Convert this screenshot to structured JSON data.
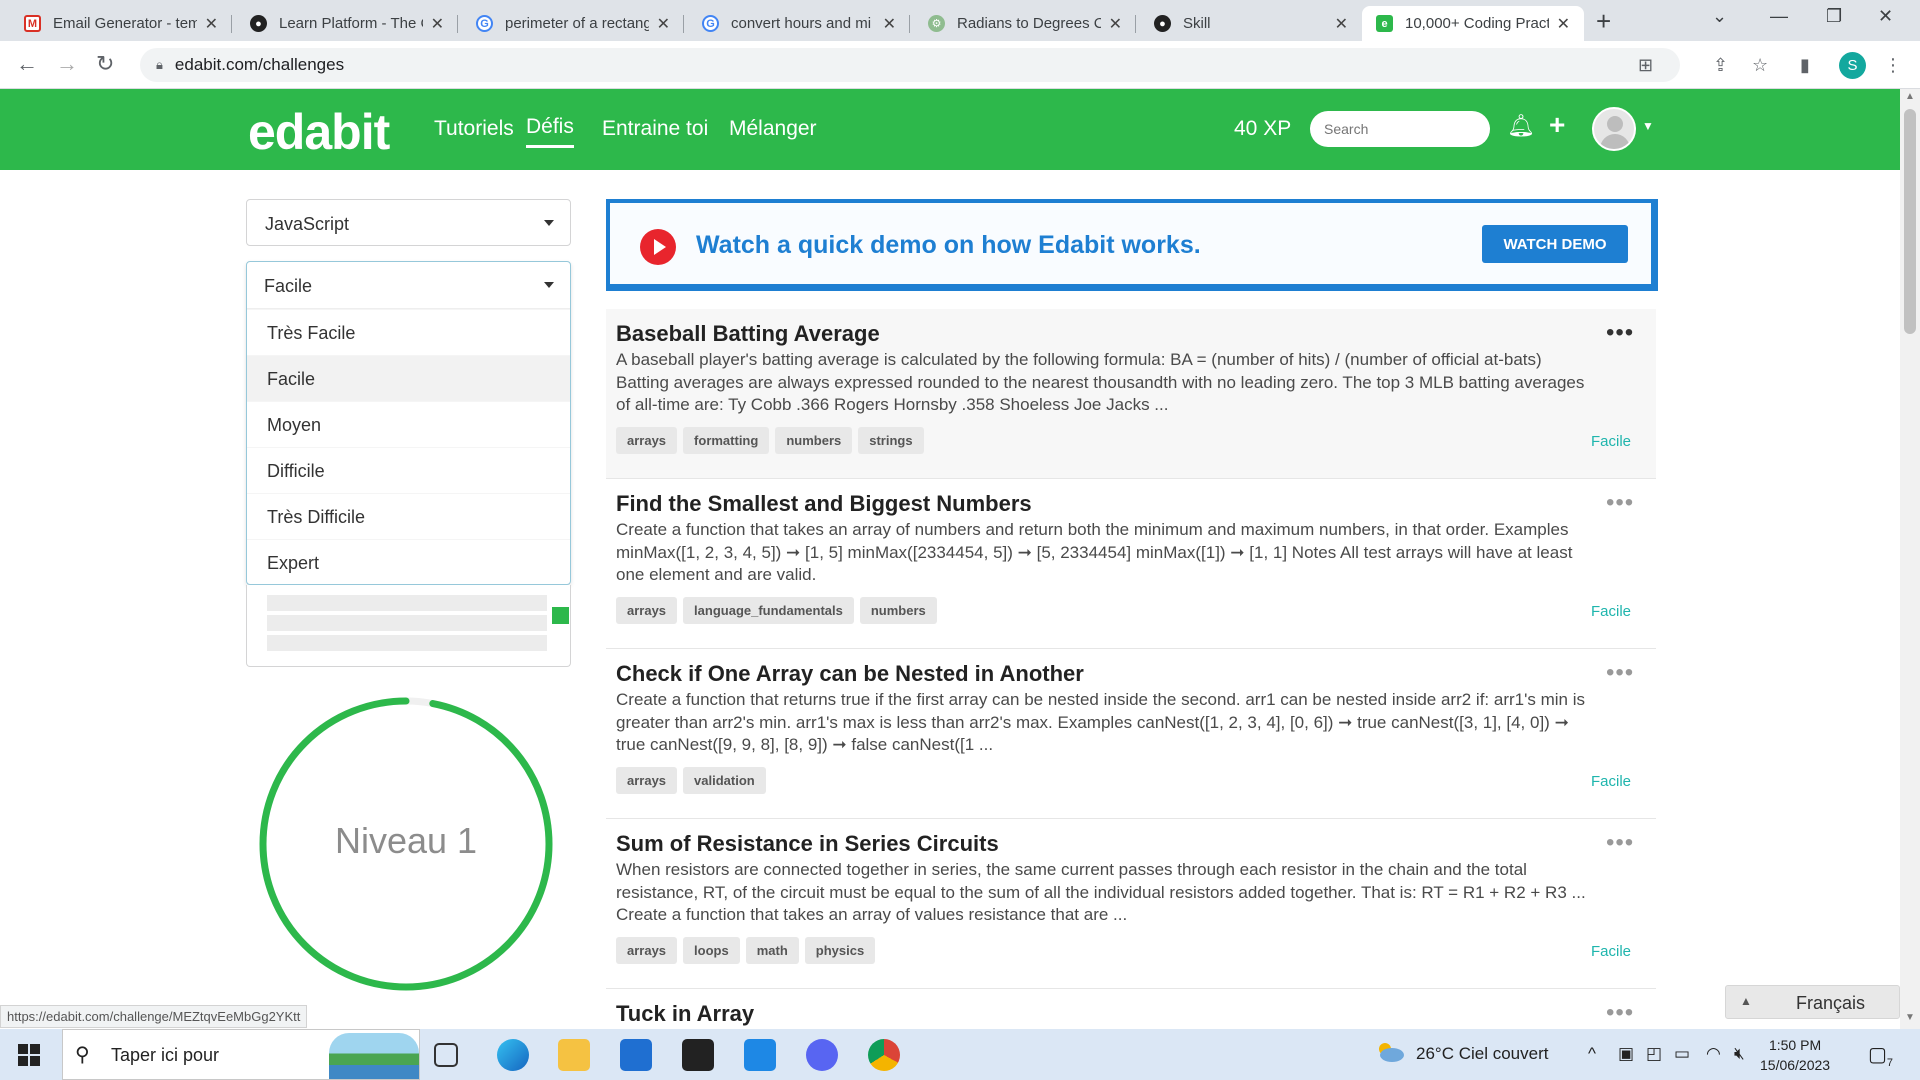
{
  "browser": {
    "tabs": [
      {
        "title": "Email Generator - tem",
        "icon": "gmail-icon"
      },
      {
        "title": "Learn Platform - The C",
        "icon": "github-icon"
      },
      {
        "title": "perimeter of a rectang",
        "icon": "google-icon"
      },
      {
        "title": "convert hours and mi",
        "icon": "google-icon"
      },
      {
        "title": "Radians to Degrees C",
        "icon": "radians-icon"
      },
      {
        "title": "Skill",
        "icon": "github-icon"
      },
      {
        "title": "10,000+ Coding Pract",
        "icon": "edabit-icon",
        "active": true
      }
    ],
    "url": "edabit.com/challenges",
    "profile_initial": "S"
  },
  "header": {
    "logo": "edabit",
    "nav": [
      "Tutoriels",
      "Défis",
      "Entraine toi",
      "Mélanger"
    ],
    "active_nav": "Défis",
    "xp": "40 XP",
    "search_placeholder": "Search"
  },
  "filters": {
    "language": "JavaScript",
    "difficulty_current": "Facile",
    "difficulty_options": [
      "Très Facile",
      "Facile",
      "Moyen",
      "Difficile",
      "Très Difficile",
      "Expert"
    ],
    "difficulty_selected": "Facile"
  },
  "level": {
    "label": "Niveau 1",
    "progress": 0.97
  },
  "demo": {
    "text": "Watch a quick demo on how Edabit works.",
    "button": "WATCH DEMO"
  },
  "challenges": [
    {
      "title": "Baseball Batting Average",
      "description": "A baseball player's batting average is calculated by the following formula: BA = (number of hits) / (number of official at-bats) Batting averages are always expressed rounded to the nearest thousandth with no leading zero. The top 3 MLB batting averages of all-time are: Ty Cobb .366 Rogers Hornsby .358 Shoeless Joe Jacks ...",
      "tags": [
        "arrays",
        "formatting",
        "numbers",
        "strings"
      ],
      "difficulty": "Facile"
    },
    {
      "title": "Find the Smallest and Biggest Numbers",
      "description": "Create a function that takes an array of numbers and return both the minimum and maximum numbers, in that order. Examples minMax([1, 2, 3, 4, 5]) ➞ [1, 5] minMax([2334454, 5]) ➞ [5, 2334454] minMax([1]) ➞ [1, 1] Notes All test arrays will have at least one element and are valid.",
      "tags": [
        "arrays",
        "language_fundamentals",
        "numbers"
      ],
      "difficulty": "Facile"
    },
    {
      "title": "Check if One Array can be Nested in Another",
      "description": "Create a function that returns true if the first array can be nested inside the second. arr1 can be nested inside arr2 if: arr1's min is greater than arr2's min. arr1's max is less than arr2's max. Examples canNest([1, 2, 3, 4], [0, 6]) ➞ true canNest([3, 1], [4, 0]) ➞ true canNest([9, 9, 8], [8, 9]) ➞ false canNest([1 ...",
      "tags": [
        "arrays",
        "validation"
      ],
      "difficulty": "Facile"
    },
    {
      "title": "Sum of Resistance in Series Circuits",
      "description": "When resistors are connected together in series, the same current passes through each resistor in the chain and the total resistance, RT, of the circuit must be equal to the sum of all the individual resistors added together. That is: RT = R1 + R2 + R3 ... Create a function that takes an array of values resistance that are ...",
      "tags": [
        "arrays",
        "loops",
        "math",
        "physics"
      ],
      "difficulty": "Facile"
    },
    {
      "title": "Tuck in Array",
      "description": "",
      "tags": [],
      "difficulty": ""
    }
  ],
  "status_url": "https://edabit.com/challenge/MEZtqvEeMbGg2YKtt",
  "language_widget": "Français",
  "taskbar": {
    "search_text": "Taper ici pour",
    "weather": "26°C  Ciel couvert",
    "time": "1:50 PM",
    "date": "15/06/2023",
    "notif_count": "7"
  }
}
